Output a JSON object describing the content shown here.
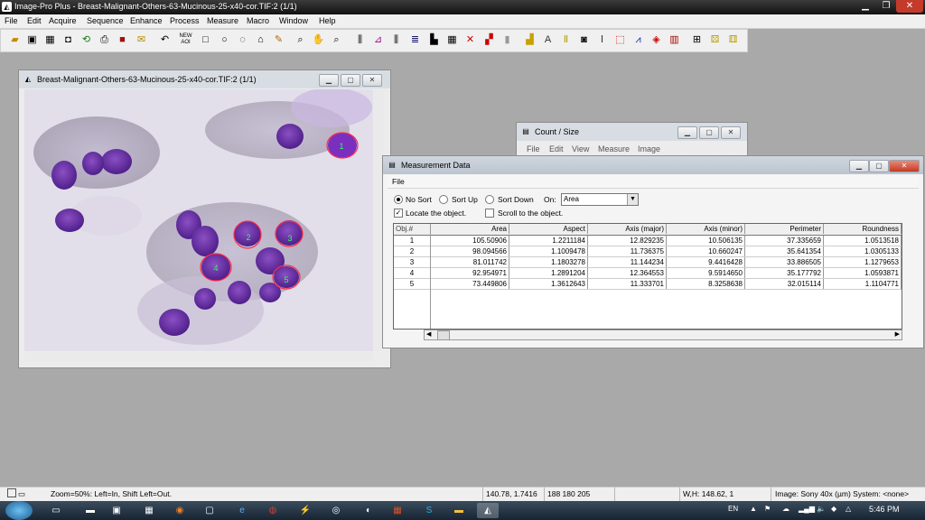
{
  "app": {
    "title": "Image-Pro Plus - Breast-Malignant-Others-63-Mucinous-25-x40-cor.TIF:2 (1/1)",
    "menu": [
      "File",
      "Edit",
      "Acquire",
      "Sequence",
      "Enhance",
      "Process",
      "Measure",
      "Macro",
      "Window",
      "Help"
    ]
  },
  "toolbar": {
    "icons": [
      "open-icon",
      "save-icon",
      "grid-icon",
      "camera-icon",
      "freehand-icon",
      "print-icon",
      "book-icon",
      "mail-icon",
      "undo-icon",
      "new-aoi-icon",
      "rectangle-icon",
      "ellipse-icon",
      "irregular-icon",
      "magic-wand-icon",
      "pencil-icon",
      "zoom-icon",
      "hand-icon",
      "zoom-out-icon",
      "histogram-icon",
      "line-profile-icon",
      "bar-icon",
      "stack-icon",
      "table-icon",
      "count-icon",
      "x-icon",
      "color-icon",
      "bitmap-icon",
      "blocks-icon",
      "af-icon",
      "measure-icon",
      "caliper-icon",
      "chart-icon",
      "3d-icon",
      "book2-icon",
      "arrange-icon",
      "dice-icon",
      "macro-icon"
    ],
    "new_aoi_label": "NEW AOI"
  },
  "image_window": {
    "title": "Breast-Malignant-Others-63-Mucinous-25-x40-cor.TIF:2 (1/1)",
    "objects": [
      "1",
      "2",
      "3",
      "4",
      "5"
    ]
  },
  "count_window": {
    "title": "Count / Size",
    "menu": [
      "File",
      "Edit",
      "View",
      "Measure",
      "Image"
    ]
  },
  "measurement_window": {
    "title": "Measurement Data",
    "file_menu": "File",
    "sort_options": [
      "No Sort",
      "Sort Up",
      "Sort Down"
    ],
    "sort_selected": "No Sort",
    "on_label": "On:",
    "on_value": "Area",
    "locate_label": "Locate the object.",
    "locate_checked": true,
    "scroll_label": "Scroll to the object.",
    "scroll_checked": false,
    "columns": [
      "Obj.#",
      "Area",
      "Aspect",
      "Axis (major)",
      "Axis (minor)",
      "Perimeter",
      "Roundness"
    ],
    "rows": [
      [
        "1",
        "105.50906",
        "1.2211184",
        "12.829235",
        "10.506135",
        "37.335659",
        "1.0513518"
      ],
      [
        "2",
        "98.094566",
        "1.1009478",
        "11.736375",
        "10.660247",
        "35.641354",
        "1.0305133"
      ],
      [
        "3",
        "81.011742",
        "1.1803278",
        "11.144234",
        "9.4416428",
        "33.886505",
        "1.1279653"
      ],
      [
        "4",
        "92.954971",
        "1.2891204",
        "12.364553",
        "9.5914650",
        "35.177792",
        "1.0593871"
      ],
      [
        "5",
        "73.449806",
        "1.3612643",
        "11.333701",
        "8.3258638",
        "32.015114",
        "1.1104771"
      ]
    ]
  },
  "status": {
    "zoom_hint": "Zoom=50%: Left=In, Shift Left=Out.",
    "coords": "140.78, 1.7416",
    "rgb": "188 180 205",
    "wh": "W,H: 148.62, 1",
    "image_info": "Image: Sony 40x (µm) System: <none>"
  },
  "taskbar": {
    "language": "EN",
    "time": "5:46 PM"
  }
}
